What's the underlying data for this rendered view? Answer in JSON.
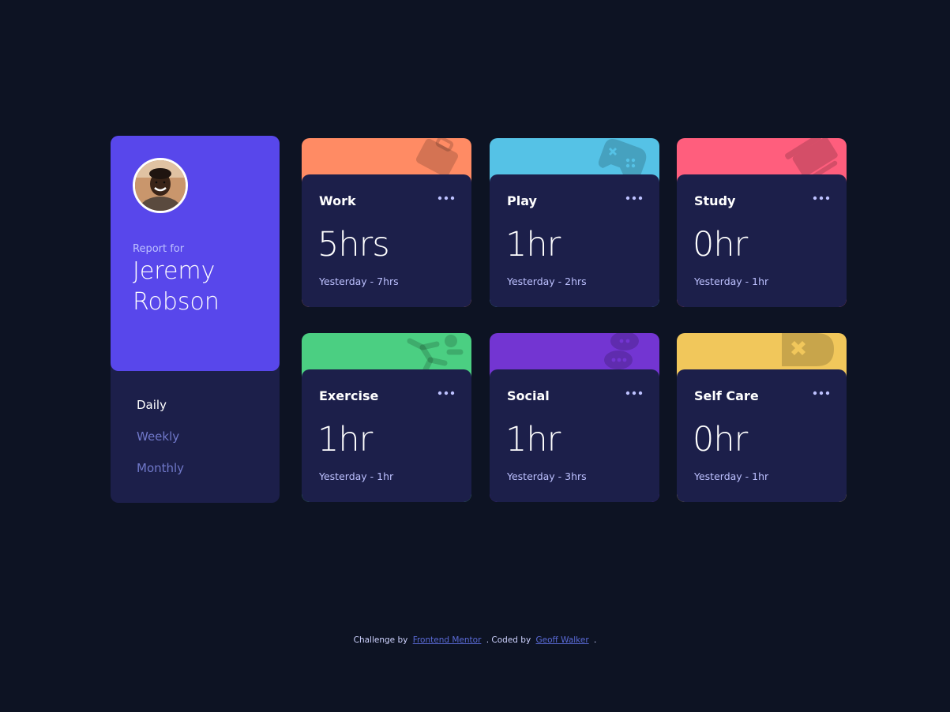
{
  "profile": {
    "report_label": "Report for",
    "name": "Jeremy Robson",
    "periods": [
      {
        "label": "Daily",
        "active": true
      },
      {
        "label": "Weekly",
        "active": false
      },
      {
        "label": "Monthly",
        "active": false
      }
    ]
  },
  "cards": [
    {
      "title": "Work",
      "current": "5hrs",
      "previous": "Yesterday - 7hrs",
      "color": "#ff8b64",
      "icon": "briefcase-icon"
    },
    {
      "title": "Play",
      "current": "1hr",
      "previous": "Yesterday - 2hrs",
      "color": "#55c2e6",
      "icon": "gamepad-icon"
    },
    {
      "title": "Study",
      "current": "0hr",
      "previous": "Yesterday - 1hr",
      "color": "#ff5e7d",
      "icon": "books-icon"
    },
    {
      "title": "Exercise",
      "current": "1hr",
      "previous": "Yesterday - 1hr",
      "color": "#4bcf82",
      "icon": "running-icon"
    },
    {
      "title": "Social",
      "current": "1hr",
      "previous": "Yesterday - 3hrs",
      "color": "#7335d2",
      "icon": "chat-bubble-icon"
    },
    {
      "title": "Self Care",
      "current": "0hr",
      "previous": "Yesterday - 1hr",
      "color": "#f1c75b",
      "icon": "heart-bandage-icon"
    }
  ],
  "footer": {
    "challenge_text": "Challenge by",
    "challenge_link": "Frontend Mentor",
    "coded_text": ". Coded by",
    "coded_link": "Geoff Walker",
    "end_text": "."
  }
}
